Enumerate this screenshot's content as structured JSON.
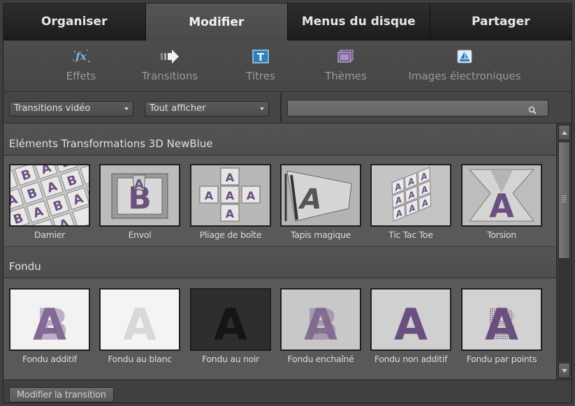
{
  "main_tabs": [
    {
      "label": "Organiser",
      "active": false
    },
    {
      "label": "Modifier",
      "active": true
    },
    {
      "label": "Menus du disque",
      "active": false
    },
    {
      "label": "Partager",
      "active": false
    }
  ],
  "sub_tabs": [
    {
      "label": "Effets",
      "icon": "fx-icon",
      "active": false
    },
    {
      "label": "Transitions",
      "icon": "arrow-right-icon",
      "active": true
    },
    {
      "label": "Titres",
      "icon": "title-t-icon",
      "active": false
    },
    {
      "label": "Thèmes",
      "icon": "themes-icon",
      "active": false
    },
    {
      "label": "Images électroniques",
      "icon": "sailboat-icon",
      "active": false
    }
  ],
  "filters": {
    "type_selected": "Transitions vidéo",
    "show_selected": "Tout afficher",
    "search_value": ""
  },
  "categories": [
    {
      "name": "Eléments Transformations 3D NewBlue",
      "items": [
        "Damier",
        "Envol",
        "Pliage de boîte",
        "Tapis magique",
        "Tic Tac Toe",
        "Torsion"
      ]
    },
    {
      "name": "Fondu",
      "items": [
        "Fondu additif",
        "Fondu au blanc",
        "Fondu au noir",
        "Fondu enchaîné",
        "Fondu non additif",
        "Fondu par points"
      ]
    }
  ],
  "bottom": {
    "edit_label": "Modifier la transition"
  },
  "colors": {
    "thumb_letter": "#6b4f7e",
    "tab_dark": "#1f1f1f",
    "panel": "#575757"
  }
}
